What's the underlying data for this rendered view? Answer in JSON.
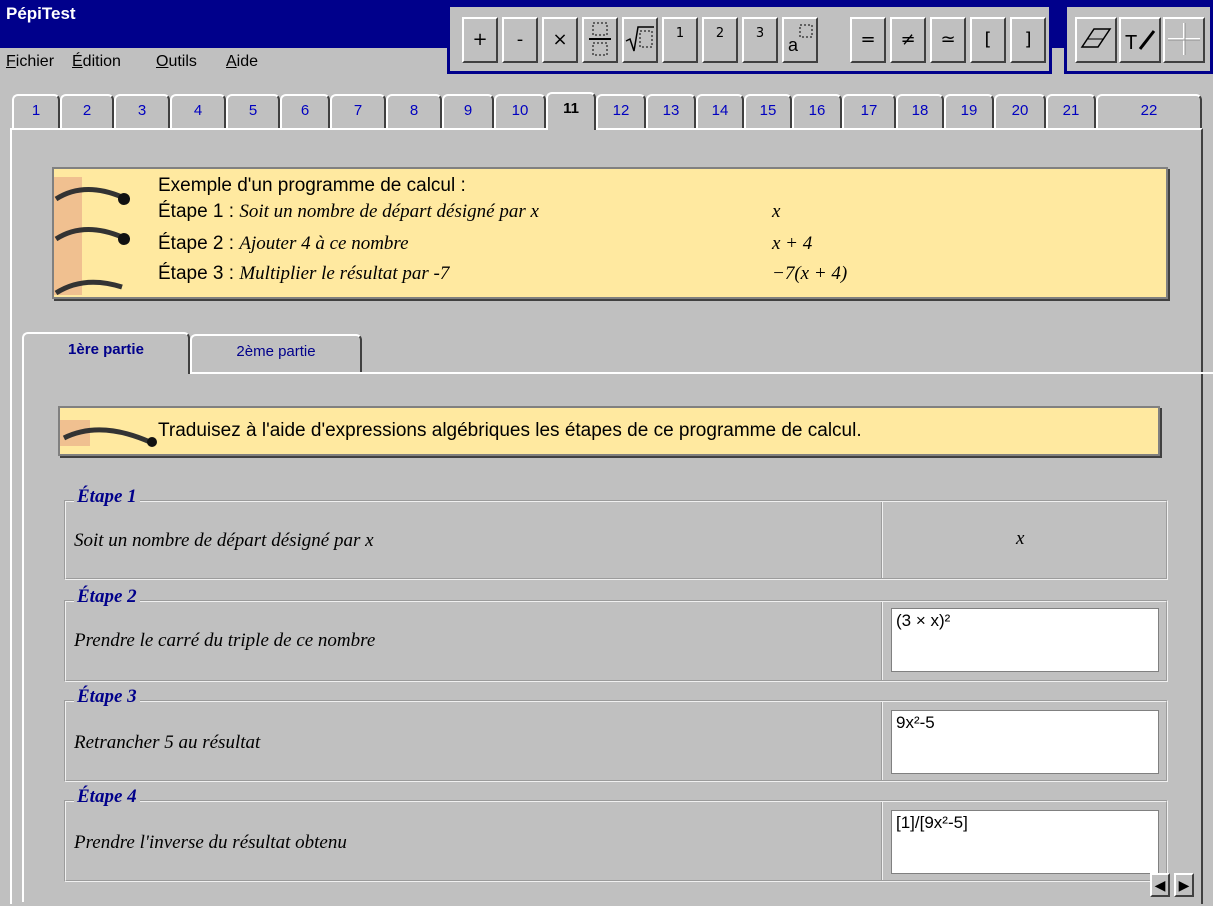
{
  "app": {
    "title": "PépiTest"
  },
  "menu": {
    "items": [
      {
        "u": "F",
        "rest": "ichier"
      },
      {
        "u": "É",
        "rest": "dition"
      },
      {
        "u": "O",
        "rest": "utils"
      },
      {
        "u": "A",
        "rest": "ide"
      }
    ]
  },
  "toolbar": {
    "buttons": [
      "+",
      "-",
      "×",
      "fraction-icon",
      "sqrt-icon",
      "1",
      "2",
      "3",
      "power-icon",
      "=",
      "≠",
      "≃",
      "[",
      "]"
    ],
    "buttons2": [
      "eraser-icon",
      "text-pen-icon",
      "cross-icon"
    ]
  },
  "tabs": [
    "1",
    "2",
    "3",
    "4",
    "5",
    "6",
    "7",
    "8",
    "9",
    "10",
    "11",
    "12",
    "13",
    "14",
    "15",
    "16",
    "17",
    "18",
    "19",
    "20",
    "21",
    "22"
  ],
  "active_tab": "11",
  "example": {
    "intro": "Exemple d'un programme de calcul :",
    "steps": [
      {
        "label": "Étape 1 : ",
        "text": "Soit un nombre de départ désigné par x",
        "expr": "x"
      },
      {
        "label": "Étape 2 : ",
        "text": "Ajouter 4 à ce nombre",
        "expr": "x + 4"
      },
      {
        "label": "Étape 3 : ",
        "text": "Multiplier le résultat par -7",
        "expr": "−7(x + 4)"
      }
    ]
  },
  "subtabs": [
    "1ère partie",
    "2ème partie"
  ],
  "instruction": "Traduisez à l'aide d'expressions algébriques les étapes de ce programme de calcul.",
  "exercise": [
    {
      "title": "Étape 1",
      "desc": "Soit un nombre de départ désigné par x",
      "answer": "x",
      "editable": false
    },
    {
      "title": "Étape 2",
      "desc": "Prendre le carré du triple de ce nombre",
      "answer": "(3 × x)²",
      "editable": true
    },
    {
      "title": "Étape 3",
      "desc": "Retrancher 5 au résultat",
      "answer": "9x²-5",
      "editable": true
    },
    {
      "title": "Étape 4",
      "desc": "Prendre l'inverse du résultat obtenu",
      "answer": "[1]/[9x²-5]",
      "editable": true
    }
  ],
  "colors": {
    "title_bar": "#00008b",
    "note_bg": "#ffe9a0",
    "tab_text": "#0000c0"
  }
}
